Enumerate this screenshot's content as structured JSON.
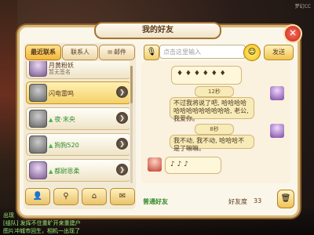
{
  "watermark": "梦幻CC",
  "window": {
    "title": "我的好友"
  },
  "tabs": [
    {
      "label": "最近联系",
      "active": true
    },
    {
      "label": "联系人",
      "active": false
    },
    {
      "label": "邮件",
      "active": false,
      "icon": "mail-icon"
    }
  ],
  "friends": [
    {
      "name": "月黄粉妖",
      "subtitle": "暂无签名",
      "avatar": "purple",
      "selected": false,
      "name_color": "normal"
    },
    {
      "name": "闪电雷鸣",
      "subtitle": "",
      "avatar": "gray",
      "selected": true,
      "name_color": "normal"
    },
    {
      "name": "夜·末央",
      "subtitle": "",
      "avatar": "gray",
      "selected": false,
      "name_color": "green"
    },
    {
      "name": "狗狗520",
      "subtitle": "",
      "avatar": "gray",
      "selected": false,
      "name_color": "green"
    },
    {
      "name": "都尉恩柔",
      "subtitle": "",
      "avatar": "purple",
      "selected": false,
      "name_color": "green"
    }
  ],
  "bottom_buttons": [
    {
      "icon": "add-friend-icon"
    },
    {
      "icon": "location-icon"
    },
    {
      "icon": "home-icon"
    },
    {
      "icon": "chat-icon"
    }
  ],
  "input": {
    "placeholder": "点击这里输入"
  },
  "send_label": "发送",
  "chat": {
    "messages": [
      {
        "from": "other",
        "type": "sticker",
        "text": ""
      },
      {
        "from": "me",
        "type": "voice",
        "duration": "12秒",
        "text": "不过我将说了吧, 哈哈哈哈哈哈哈哈哈哈哈哈哈, 老公, 我爱你。"
      },
      {
        "from": "me",
        "type": "voice",
        "duration": "8秒",
        "text": "我不动, 我不动, 哈哈哈不是了嘛嘛。"
      },
      {
        "from": "other",
        "type": "sticker",
        "text": ""
      }
    ]
  },
  "footer": {
    "relation": "普通好友",
    "affinity_label": "好友度",
    "affinity_value": "33"
  },
  "ticker": [
    "出现",
    "[组队] 发挥不住重旷开来重建户",
    "图片冲城市回生，相机一出现了"
  ]
}
